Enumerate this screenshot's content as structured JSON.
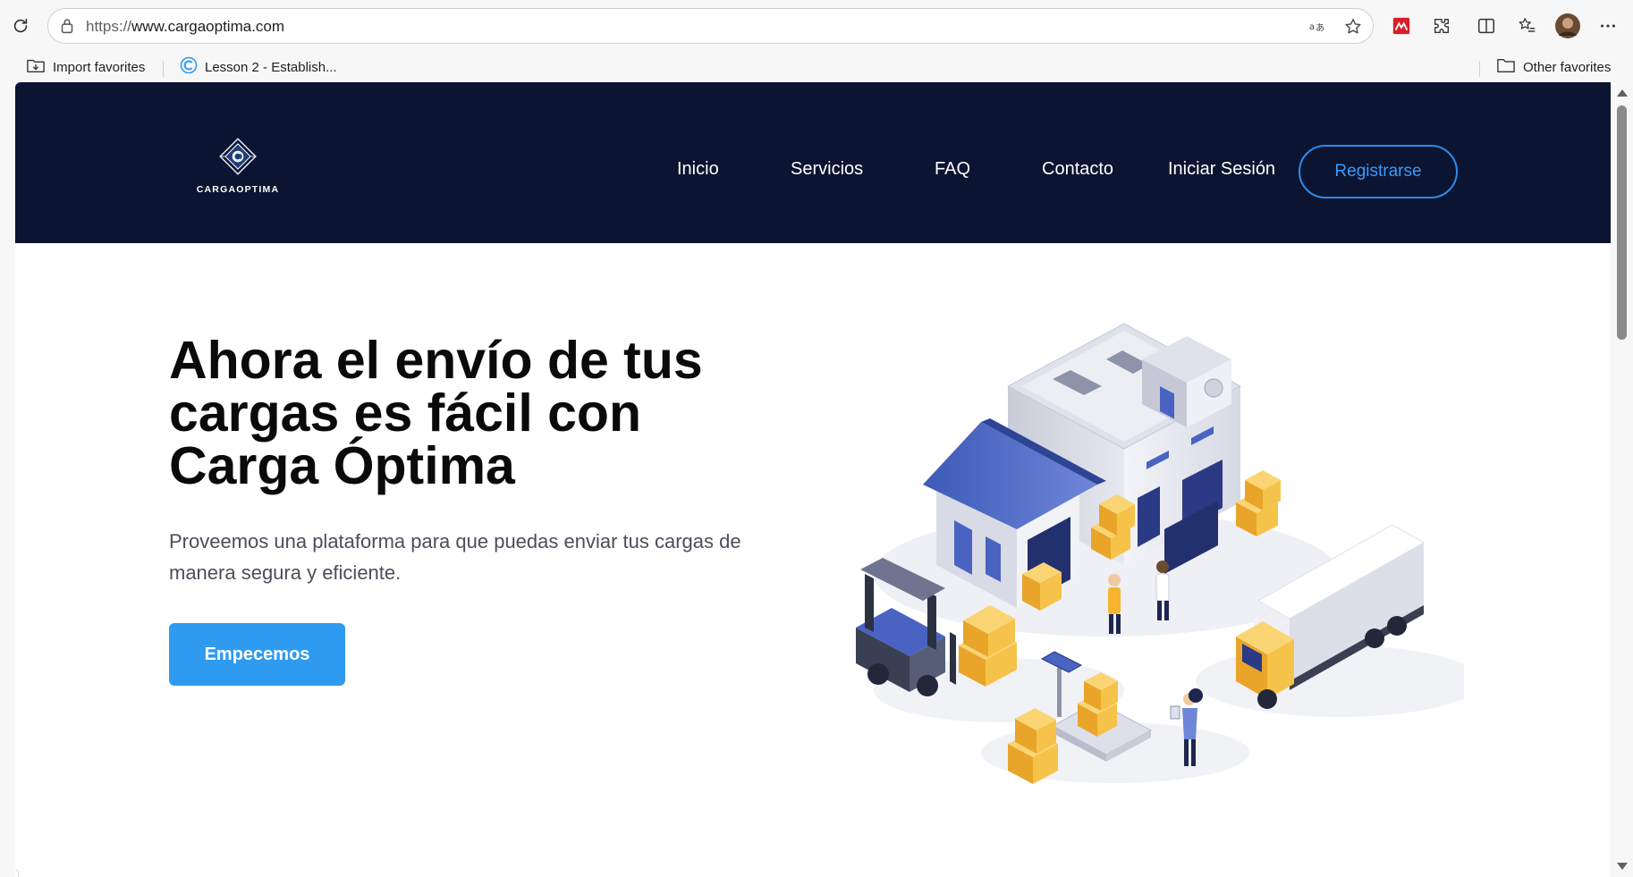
{
  "browser": {
    "url_protocol": "https://",
    "url_host": "www.cargaoptima.com",
    "favorites": [
      {
        "label": "Import favorites"
      },
      {
        "label": "Lesson 2 - Establish..."
      }
    ],
    "other_favorites": "Other favorites"
  },
  "header": {
    "logo_text": "CARGAOPTIMA",
    "nav": [
      "Inicio",
      "Servicios",
      "FAQ",
      "Contacto",
      "Iniciar Sesión"
    ],
    "register_label": "Registrarse"
  },
  "hero": {
    "title_line1": "Ahora el envío de tus",
    "title_line2": "cargas es fácil con",
    "title_line3": "Carga Óptima",
    "subtitle": "Proveemos una plataforma para que puedas enviar tus cargas de manera segura y eficiente.",
    "cta_label": "Empecemos"
  },
  "colors": {
    "header_bg": "#0b1430",
    "accent_blue": "#2f9bf0",
    "outline_blue": "#2a8cf0"
  }
}
